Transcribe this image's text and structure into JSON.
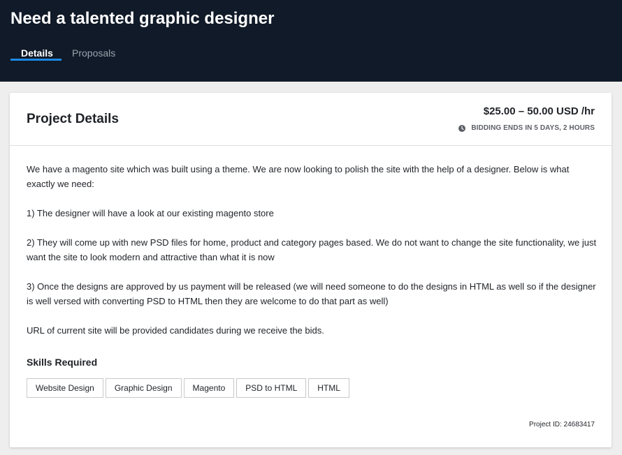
{
  "header": {
    "title": "Need a talented graphic designer",
    "tabs": [
      {
        "label": "Details",
        "active": true
      },
      {
        "label": "Proposals",
        "active": false
      }
    ]
  },
  "project": {
    "heading": "Project Details",
    "budget": "$25.00 – 50.00 USD /hr",
    "bidding": "BIDDING ENDS IN 5 DAYS, 2 HOURS",
    "description": [
      "We have a magento site which was built using a theme. We are now looking to polish the site with the help of a designer. Below is what exactly we need:",
      "1) The designer will have a look at our existing magento store",
      "2) They will come up with new PSD files for home, product and category pages based. We do not want to change the site functionality, we just want the site to look modern and attractive than what it is now",
      "3) Once the designs are approved by us payment will be released (we will need someone to do the designs in HTML as well so if the designer is well versed with converting PSD to HTML then they are welcome to do that part as well)",
      "URL of current site will be provided candidates during we receive the bids."
    ],
    "skills_heading": "Skills Required",
    "skills": [
      "Website Design",
      "Graphic Design",
      "Magento",
      "PSD to HTML",
      "HTML"
    ],
    "project_id": "Project ID: 24683417"
  },
  "colors": {
    "header_bg": "#101a28",
    "tab_indicator": "#1e88e5",
    "page_bg": "#eeeeee"
  },
  "icons": {
    "bidding": "clock-icon"
  }
}
